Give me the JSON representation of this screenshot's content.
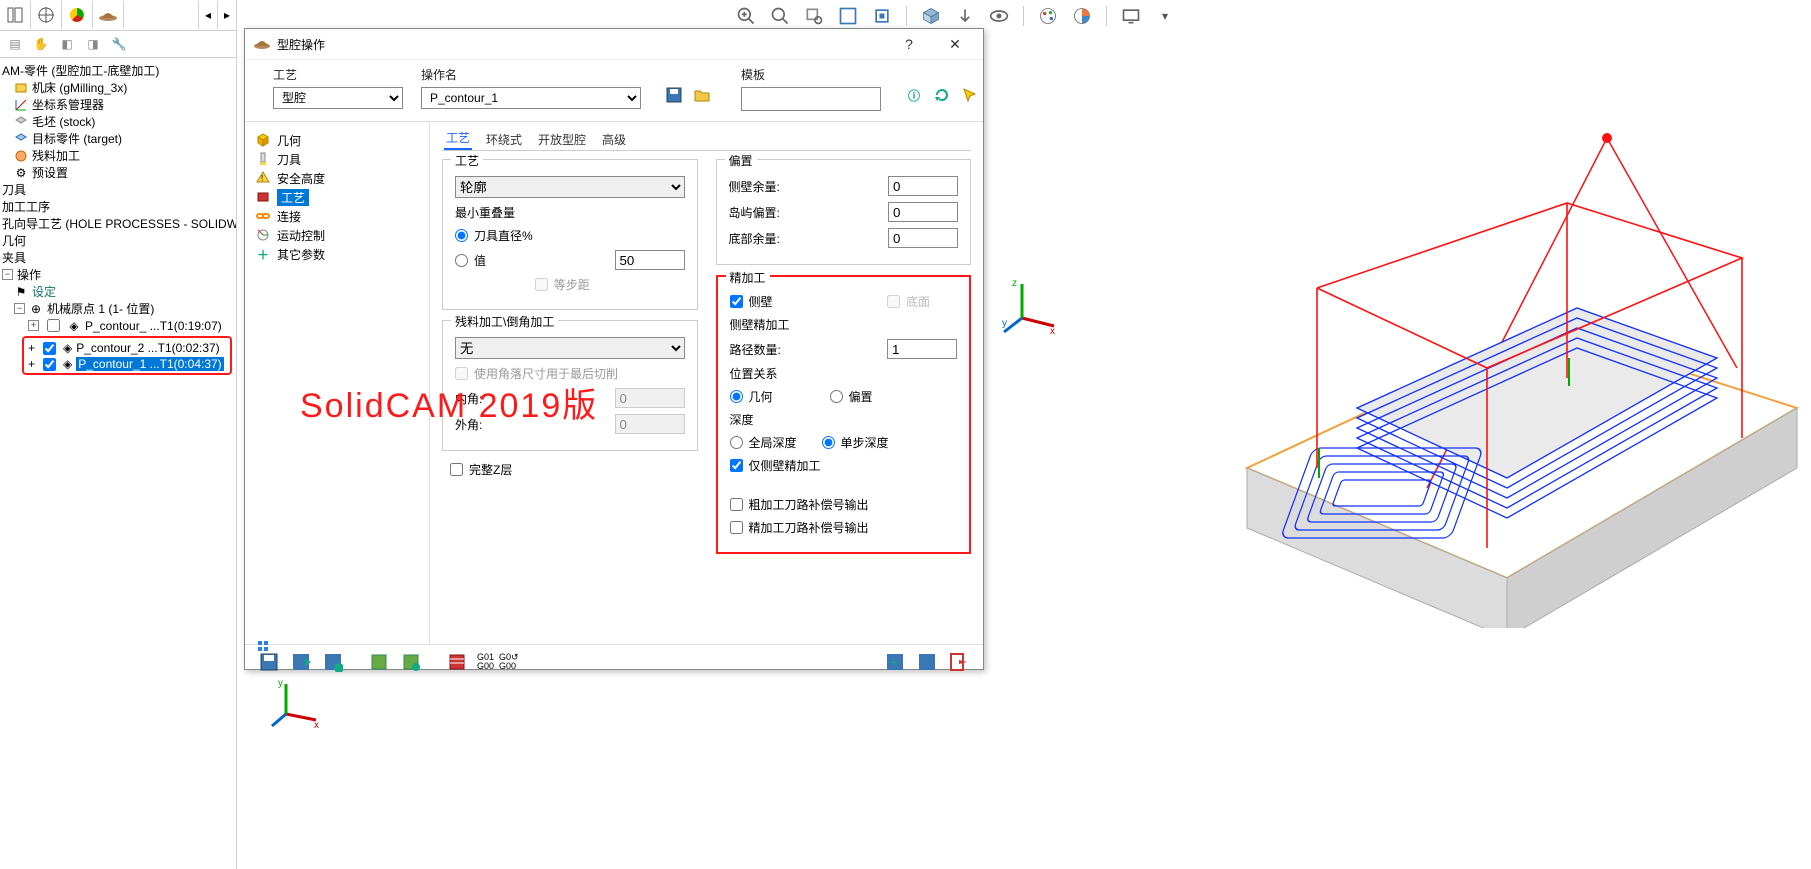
{
  "app": {
    "title": "型腔操作",
    "help": "?",
    "close": "✕"
  },
  "overlay": "SolidCAM   2019版",
  "view_toolbar_icons": [
    "zoom-in-icon",
    "zoom-out-icon",
    "zoom-area-icon",
    "fit-icon",
    "box-fit-icon",
    "iso-view-icon",
    "arrow-down-icon",
    "eye-icon",
    "palette1-icon",
    "palette2-icon",
    "screen-icon",
    "dropdown-icon"
  ],
  "left_toolbar": {
    "icons": [
      "panel1-icon",
      "target-icon",
      "pie-icon",
      "hat-icon"
    ]
  },
  "left_toolbar2": {
    "icons": [
      "layers-icon",
      "hand-icon",
      "layers2-icon",
      "layers3-icon",
      "wrench-icon"
    ]
  },
  "tree": {
    "root": "AM-零件 (型腔加工-底壁加工)",
    "items": [
      {
        "icon": "machine",
        "label": "机床 (gMilling_3x)"
      },
      {
        "icon": "coord",
        "label": "坐标系管理器"
      },
      {
        "icon": "stock",
        "label": "毛坯 (stock)"
      },
      {
        "icon": "target",
        "label": "目标零件 (target)"
      },
      {
        "icon": "rest",
        "label": "残料加工"
      },
      {
        "icon": "preset",
        "label": "预设置"
      },
      {
        "icon": "tool",
        "label": "刀具"
      },
      {
        "icon": "proc",
        "label": "加工工序"
      },
      {
        "icon": "hole",
        "label": "孔向导工艺 (HOLE PROCESSES - SOLIDWORKS"
      },
      {
        "icon": "geom",
        "label": "几何"
      },
      {
        "icon": "fixt",
        "label": "夹具"
      }
    ],
    "ops_header": "操作",
    "settings": "设定",
    "origin": "机械原点 1 (1- 位置)",
    "op0": "P_contour_ ...T1(0:19:07)",
    "op1": "P_contour_2 ...T1(0:02:37)",
    "op2": "P_contour_1 ...T1(0:04:37)"
  },
  "dlg": {
    "tech_label": "工艺",
    "tech_value": "型腔",
    "opname_label": "操作名",
    "opname_value": "P_contour_1",
    "tmpl_label": "模板",
    "tmpl_value": "",
    "side": [
      {
        "icon": "geom",
        "label": "几何"
      },
      {
        "icon": "tool",
        "label": "刀具"
      },
      {
        "icon": "safe",
        "label": "安全高度"
      },
      {
        "icon": "tech",
        "label": "工艺",
        "sel": true
      },
      {
        "icon": "link",
        "label": "连接"
      },
      {
        "icon": "motion",
        "label": "运动控制"
      },
      {
        "icon": "other",
        "label": "其它参数"
      }
    ],
    "tabs": [
      "工艺",
      "环绕式",
      "开放型腔",
      "高级"
    ],
    "tech": {
      "group_title": "工艺",
      "contour": "轮廓",
      "overlap_title": "最小重叠量",
      "tool_dia": "刀具直径%",
      "value": "值",
      "value_num": "50",
      "equal": "等步距",
      "chamfer_title": "残料加工\\倒角加工",
      "chamfer_sel": "无",
      "corners": "使用角落尺寸用于最后切削",
      "fillet_in": "内角:",
      "fillet_in_v": "0",
      "fillet_out": "外角:",
      "fillet_out_v": "0",
      "fullz": "完整Z层"
    },
    "offset": {
      "group_title": "偏置",
      "wall": "侧壁余量:",
      "wall_v": "0",
      "island": "岛屿偏置:",
      "island_v": "0",
      "floor": "底部余量:",
      "floor_v": "0"
    },
    "finish": {
      "group_title": "精加工",
      "wall_chk": "侧壁",
      "floor_chk": "底面",
      "wallfin_title": "侧壁精加工",
      "paths": "路径数量:",
      "paths_v": "1",
      "pos_title": "位置关系",
      "pos_geom": "几何",
      "pos_off": "偏置",
      "depth_title": "深度",
      "depth_all": "全局深度",
      "depth_step": "单步深度",
      "only_wall": "仅侧壁精加工",
      "comp_rough": "粗加工刀路补偿号输出",
      "comp_fin": "精加工刀路补偿号输出"
    },
    "footer": {
      "gcodes": "G01  G0↺\nG00  G00"
    }
  }
}
